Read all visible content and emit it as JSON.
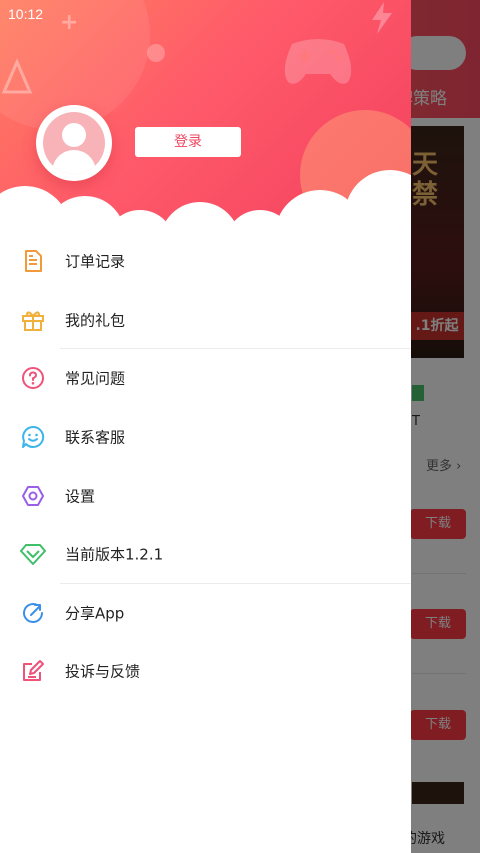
{
  "status_bar": {
    "time": "10:12"
  },
  "background_app": {
    "tab_label": "牌策略",
    "banner_title": "天 禁",
    "discount": ".1折起",
    "badge_text": "T",
    "more_label": "更多 ›",
    "download_label": "下载",
    "bottom_nav_label": "的游戏"
  },
  "drawer": {
    "login_label": "登录",
    "menu_items": [
      {
        "label": "订单记录",
        "icon": "document-icon",
        "color": "#f29a3a"
      },
      {
        "label": "我的礼包",
        "icon": "gift-icon",
        "color": "#f0b13c"
      },
      {
        "label": "常见问题",
        "icon": "question-icon",
        "color": "#f0527a"
      },
      {
        "label": "联系客服",
        "icon": "smile-chat-icon",
        "color": "#3cb4ec"
      },
      {
        "label": "设置",
        "icon": "hexagon-settings-icon",
        "color": "#9a5ee8"
      },
      {
        "label": "当前版本1.2.1",
        "icon": "diamond-icon",
        "color": "#3fbf6a"
      },
      {
        "label": "分享App",
        "icon": "share-icon",
        "color": "#3b8fe8"
      },
      {
        "label": "投诉与反馈",
        "icon": "edit-feedback-icon",
        "color": "#f0527a"
      }
    ]
  },
  "colors": {
    "accent": "#f0475f",
    "header_gradient_start": "#ff7e5f",
    "header_gradient_end": "#f2405e"
  }
}
